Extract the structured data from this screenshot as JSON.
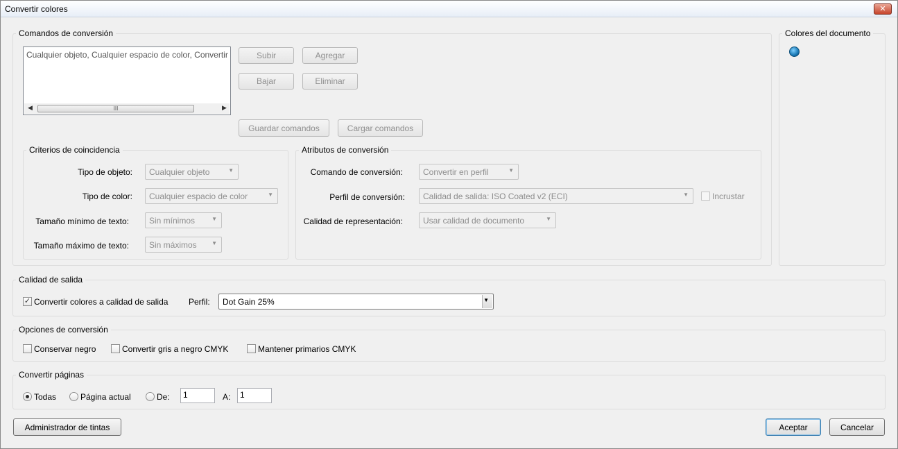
{
  "window": {
    "title": "Convertir colores",
    "close_glyph": "✕"
  },
  "conversion_commands": {
    "label": "Comandos de conversión",
    "list_items": [
      "Cualquier objeto, Cualquier espacio de color, Convertir"
    ],
    "scroll_thumb": "III",
    "buttons": {
      "up": "Subir",
      "add": "Agregar",
      "down": "Bajar",
      "delete": "Eliminar",
      "save": "Guardar comandos",
      "load": "Cargar comandos"
    }
  },
  "match_criteria": {
    "label": "Criterios de coincidencia",
    "object_type": {
      "label": "Tipo de objeto:",
      "value": "Cualquier objeto"
    },
    "color_type": {
      "label": "Tipo de color:",
      "value": "Cualquier espacio de color"
    },
    "min_text_size": {
      "label": "Tamaño mínimo de texto:",
      "value": "Sin mínimos"
    },
    "max_text_size": {
      "label": "Tamaño máximo de texto:",
      "value": "Sin máximos"
    }
  },
  "conversion_attributes": {
    "label": "Atributos de conversión",
    "command": {
      "label": "Comando de conversión:",
      "value": "Convertir en perfil"
    },
    "profile": {
      "label": "Perfil de conversión:",
      "value": "Calidad de salida: ISO Coated v2 (ECI)"
    },
    "embed": {
      "label": "Incrustar",
      "checked": false
    },
    "rendering": {
      "label": "Calidad de representación:",
      "value": "Usar calidad de documento"
    }
  },
  "document_colors": {
    "label": "Colores del documento",
    "color": "#1a79b5"
  },
  "output_intent": {
    "label": "Calidad de salida",
    "convert_checkbox": {
      "label": "Convertir colores a calidad de salida",
      "checked": true
    },
    "profile_label": "Perfil:",
    "profile_value": "Dot Gain 25%"
  },
  "conversion_options": {
    "label": "Opciones de conversión",
    "preserve_black": {
      "label": "Conservar negro",
      "checked": false
    },
    "gray_to_cmyk_black": {
      "label": "Convertir gris a negro CMYK",
      "checked": false
    },
    "preserve_cmyk_primaries": {
      "label": "Mantener primarios CMYK",
      "checked": false
    }
  },
  "convert_pages": {
    "label": "Convertir páginas",
    "all": {
      "label": "Todas",
      "selected": true
    },
    "current": {
      "label": "Página actual",
      "selected": false
    },
    "from": {
      "label": "De:",
      "selected": false,
      "value": "1"
    },
    "to": {
      "label": "A:",
      "value": "1"
    }
  },
  "footer": {
    "ink_manager": "Administrador de tintas",
    "ok": "Aceptar",
    "cancel": "Cancelar"
  }
}
